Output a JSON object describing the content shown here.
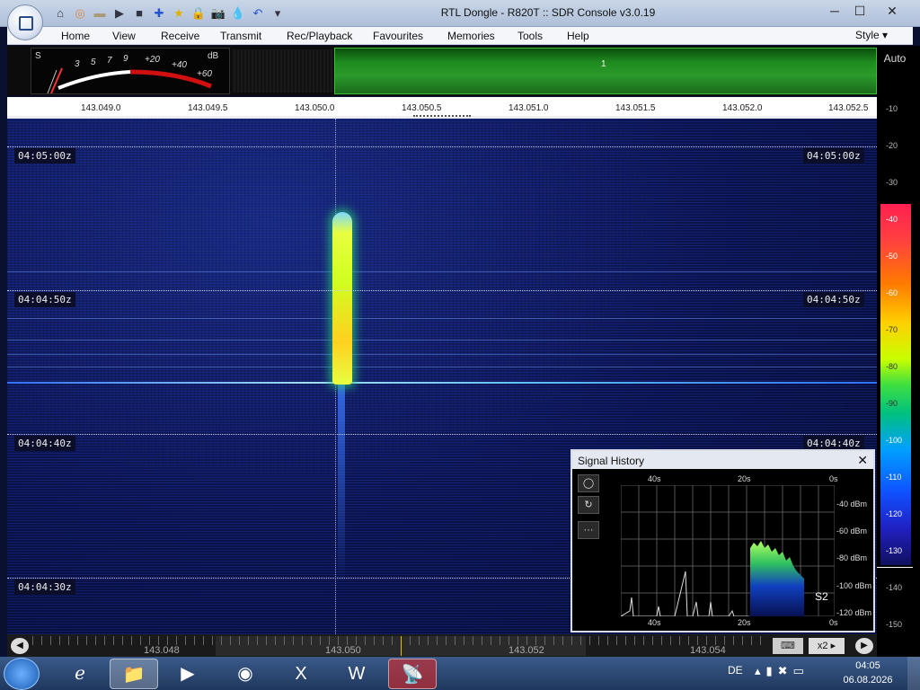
{
  "window": {
    "title": "RTL Dongle - R820T :: SDR Console v3.0.19",
    "minimize": "─",
    "maximize": "☐",
    "close": "✕"
  },
  "qat": [
    {
      "icon": "home-icon",
      "glyph": "⌂"
    },
    {
      "icon": "lifebuoy-icon",
      "glyph": "◎"
    },
    {
      "icon": "folder-icon",
      "glyph": "▬"
    },
    {
      "icon": "play-icon",
      "glyph": "▶"
    },
    {
      "icon": "stop-icon",
      "glyph": "■"
    },
    {
      "icon": "add-icon",
      "glyph": "✚"
    },
    {
      "icon": "star-icon",
      "glyph": "★"
    },
    {
      "icon": "lock-icon",
      "glyph": "🔒"
    },
    {
      "icon": "camera-icon",
      "glyph": "📷"
    },
    {
      "icon": "drop-icon",
      "glyph": "💧"
    },
    {
      "icon": "undo-icon",
      "glyph": "↶"
    },
    {
      "icon": "dropdown-icon",
      "glyph": "▾"
    }
  ],
  "menu": [
    "Home",
    "View",
    "Receive",
    "Transmit",
    "Rec/Playback",
    "Favourites",
    "Memories",
    "Tools",
    "Help"
  ],
  "style_label": "Style",
  "smeter": {
    "s_label": "S",
    "db_label": "dB",
    "marks": [
      "3",
      "5",
      "7",
      "9",
      "+20",
      "+40",
      "+60"
    ]
  },
  "filter_label": "1",
  "auto_label": "Auto",
  "right_scale": [
    "-10",
    "-20",
    "-30",
    "-40",
    "-50",
    "-60",
    "-70",
    "-80",
    "-90",
    "-100",
    "-110",
    "-120",
    "-130",
    "-140",
    "-150"
  ],
  "freq_axis": [
    "143.049.0",
    "143.049.5",
    "143.050.0",
    "143.050.5",
    "143.051.0",
    "143.051.5",
    "143.052.0",
    "143.052.5"
  ],
  "time_labels": [
    "04:05:00z",
    "04:04:50z",
    "04:04:40z",
    "04:04:30z"
  ],
  "bottom_freqs": [
    "143.048",
    "143.050",
    "143.052",
    "143.054"
  ],
  "zoom": "x2",
  "signal_history": {
    "title": "Signal History",
    "x_top": [
      "40s",
      "20s",
      "0s"
    ],
    "x_bottom": [
      "40s",
      "20s",
      "0s"
    ],
    "y_labels": [
      "-40 dBm",
      "-60 dBm",
      "-80 dBm",
      "-100 dBm",
      "-120 dBm"
    ],
    "s_reading": "S2",
    "buttons": [
      "◯",
      "↻",
      "···"
    ]
  },
  "taskbar": {
    "lang": "DE",
    "time": "04:05",
    "date": "06.08.2026"
  }
}
